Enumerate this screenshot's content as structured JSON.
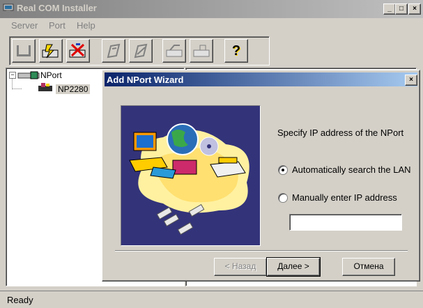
{
  "window": {
    "title": "Real COM Installer",
    "min_glyph": "_",
    "max_glyph": "□",
    "close_glyph": "×"
  },
  "menu": [
    "Server",
    "Port",
    "Help"
  ],
  "toolbar": {
    "help_glyph": "?"
  },
  "tree": {
    "root_label": "NPort",
    "child_label": "NP2280"
  },
  "status": {
    "text": "Ready"
  },
  "dialog": {
    "title": "Add NPort Wizard",
    "close_glyph": "×",
    "prompt": "Specify IP address of the NPort",
    "option_auto": "Automatically search the LAN",
    "option_manual": "Manually enter IP address",
    "selected_option": "auto",
    "ip_value": "",
    "back_label": "< Назад",
    "next_label": "Далее >",
    "cancel_label": "Отмена"
  },
  "colors": {
    "dialog_title_start": "#0a246a",
    "dialog_title_end": "#a6caf0",
    "inactive_title": "#808080",
    "wizard_bg": "#33337a"
  },
  "icons": {
    "toolbar": [
      "add-server-icon",
      "auto-search-icon",
      "remove-server-icon",
      "map-port-icon",
      "unmap-port-icon",
      "upgrade-firmware-icon",
      "export-config-icon",
      "help-icon"
    ],
    "tree_root": "server-icon",
    "tree_child": "nport-device-icon"
  }
}
